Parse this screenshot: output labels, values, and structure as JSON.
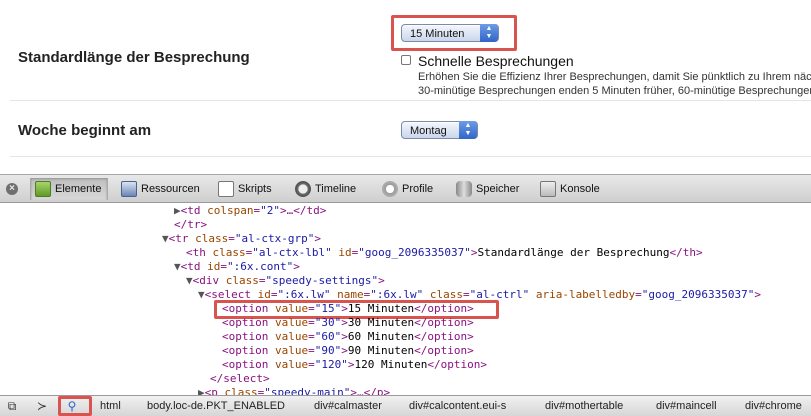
{
  "settings": {
    "duration_label": "Standardlänge der Besprechung",
    "duration_value": "15 Minuten",
    "quick_meetings_label": "Schnelle Besprechungen",
    "quick_meetings_desc_1": "Erhöhen Sie die Effizienz Ihrer Besprechungen, damit Sie pünktlich zu Ihrem näch",
    "quick_meetings_desc_2": "30-minütige Besprechungen enden 5 Minuten früher, 60-minütige Besprechungen",
    "week_start_label": "Woche beginnt am",
    "week_start_value": "Montag"
  },
  "toolbar": {
    "tabs": [
      "Elemente",
      "Ressourcen",
      "Skripts",
      "Timeline",
      "Profile",
      "Speicher",
      "Konsole"
    ]
  },
  "tree": {
    "l0": {
      "pre": "<",
      "tag": "td",
      "a1": "colspan",
      "v1": "\"2\"",
      "post": ">…</td>"
    },
    "l1": "</tr>",
    "l2": {
      "tag": "tr",
      "a1": "class",
      "v1": "\"al-ctx-grp\""
    },
    "l3": {
      "tag": "th",
      "a1": "class",
      "v1": "\"al-ctx-lbl\"",
      "a2": "id",
      "v2": "\"goog_2096335037\"",
      "text": "Standardlänge der Besprechung",
      "close": "</th>"
    },
    "l4": {
      "tag": "td",
      "a1": "id",
      "v1": "\":6x.cont\""
    },
    "l5": {
      "tag": "div",
      "a1": "class",
      "v1": "\"speedy-settings\""
    },
    "l6": {
      "tag": "select",
      "a1": "id",
      "v1": "\":6x.lw\"",
      "a2": "name",
      "v2": "\":6x.lw\"",
      "a3": "class",
      "v3": "\"al-ctrl\"",
      "a4": "aria-labelledby",
      "v4": "\"goog_2096335037\""
    },
    "options": [
      {
        "value": "\"15\"",
        "text": "15 Minuten"
      },
      {
        "value": "\"30\"",
        "text": "30 Minuten"
      },
      {
        "value": "\"60\"",
        "text": "60 Minuten"
      },
      {
        "value": "\"90\"",
        "text": "90 Minuten"
      },
      {
        "value": "\"120\"",
        "text": "120 Minuten"
      }
    ],
    "l12": "</select>",
    "l13": {
      "tag": "p",
      "a1": "class",
      "v1": "\"speedy-main\"",
      "post": ">…</p>"
    }
  },
  "statusbar": {
    "crumbs": [
      "html",
      "body.loc-de.PKT_ENABLED",
      "div#calmaster",
      "div#calcontent.eui-s",
      "div#mothertable",
      "div#maincell",
      "div#chrome"
    ]
  },
  "colors": {
    "highlight": "#d9534f",
    "tag": "#881280",
    "attr": "#994500",
    "value": "#1a1aa6"
  }
}
